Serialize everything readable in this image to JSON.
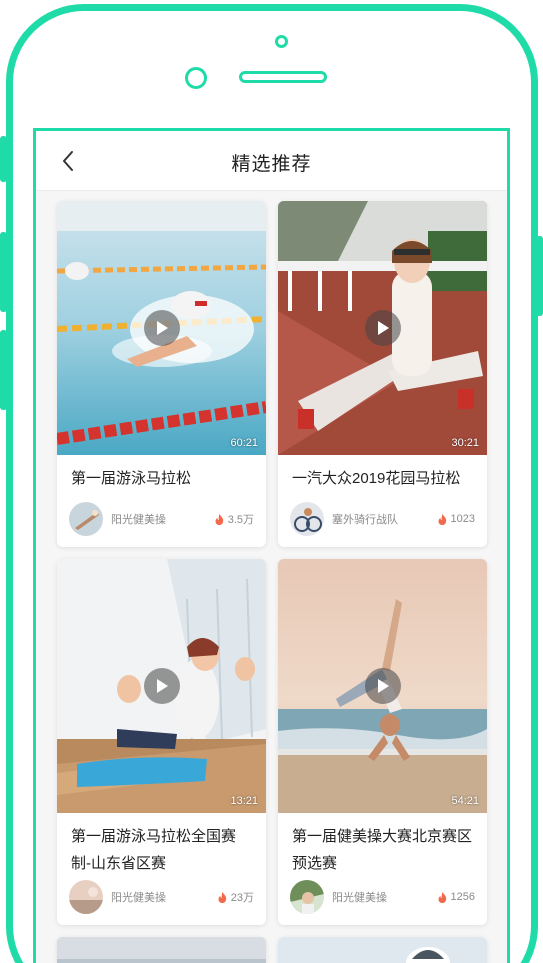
{
  "nav": {
    "title": "精选推荐",
    "back_icon": "chevron-left-icon"
  },
  "colors": {
    "frame_accent": "#1fdba8",
    "flame": "#f26a4b"
  },
  "cards": [
    {
      "title": "第一届游泳马拉松",
      "duration": "60:21",
      "author": "阳光健美操",
      "likes": "3.5万"
    },
    {
      "title": "一汽大众2019花园马拉松",
      "duration": "30:21",
      "author": "塞外骑行战队",
      "likes": "1023"
    },
    {
      "title": "第一届游泳马拉松全国赛制-山东省区赛",
      "duration": "13:21",
      "author": "阳光健美操",
      "likes": "23万"
    },
    {
      "title": "第一届健美操大赛北京赛区预选赛",
      "duration": "54:21",
      "author": "阳光健美操",
      "likes": "1256"
    }
  ]
}
